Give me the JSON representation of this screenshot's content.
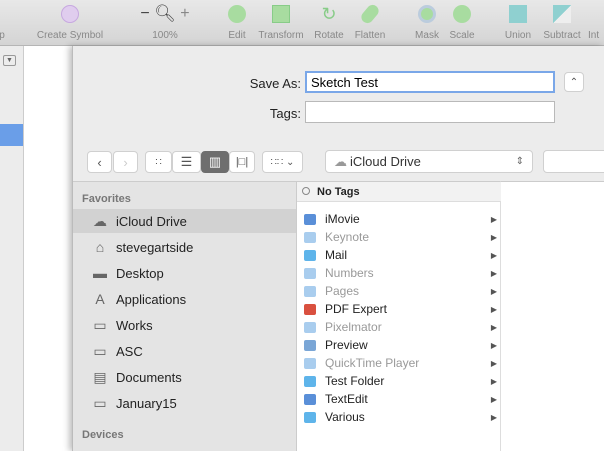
{
  "toolbar": {
    "items": [
      {
        "label": "p"
      },
      {
        "label": "Create Symbol"
      },
      {
        "label": "100%",
        "minus": "−",
        "plus": "+"
      },
      {
        "label": "Edit"
      },
      {
        "label": "Transform"
      },
      {
        "label": "Rotate"
      },
      {
        "label": "Flatten"
      },
      {
        "label": "Mask"
      },
      {
        "label": "Scale"
      },
      {
        "label": "Union"
      },
      {
        "label": "Subtract"
      },
      {
        "label": "Int"
      }
    ]
  },
  "dialog": {
    "save_as_label": "Save As:",
    "save_as_value": "Sketch Test",
    "tags_label": "Tags:",
    "tags_value": "",
    "location": "iCloud Drive",
    "sidebar": {
      "favorites_header": "Favorites",
      "devices_header": "Devices",
      "items": [
        {
          "label": "iCloud Drive",
          "icon": "cloud-icon",
          "selected": true
        },
        {
          "label": "stevegartside",
          "icon": "home-icon"
        },
        {
          "label": "Desktop",
          "icon": "desktop-icon"
        },
        {
          "label": "Applications",
          "icon": "applications-icon"
        },
        {
          "label": "Works",
          "icon": "folder-icon"
        },
        {
          "label": "ASC",
          "icon": "folder-icon"
        },
        {
          "label": "Documents",
          "icon": "documents-icon"
        },
        {
          "label": "January15",
          "icon": "folder-icon"
        }
      ]
    },
    "column": {
      "header": "No Tags",
      "items": [
        {
          "label": "iMovie",
          "dim": false,
          "color": "#5a8fd8"
        },
        {
          "label": "Keynote",
          "dim": true,
          "color": "#a9cdee"
        },
        {
          "label": "Mail",
          "dim": false,
          "color": "#5eb4ea"
        },
        {
          "label": "Numbers",
          "dim": true,
          "color": "#a9cdee"
        },
        {
          "label": "Pages",
          "dim": true,
          "color": "#a9cdee"
        },
        {
          "label": "PDF Expert",
          "dim": false,
          "color": "#d9503f"
        },
        {
          "label": "Pixelmator",
          "dim": true,
          "color": "#a9cdee"
        },
        {
          "label": "Preview",
          "dim": false,
          "color": "#7aa6d6"
        },
        {
          "label": "QuickTime Player",
          "dim": true,
          "color": "#a9cdee"
        },
        {
          "label": "Test Folder",
          "dim": false,
          "color": "#5eb4ea"
        },
        {
          "label": "TextEdit",
          "dim": false,
          "color": "#5a8fd8"
        },
        {
          "label": "Various",
          "dim": false,
          "color": "#5eb4ea"
        }
      ]
    }
  }
}
